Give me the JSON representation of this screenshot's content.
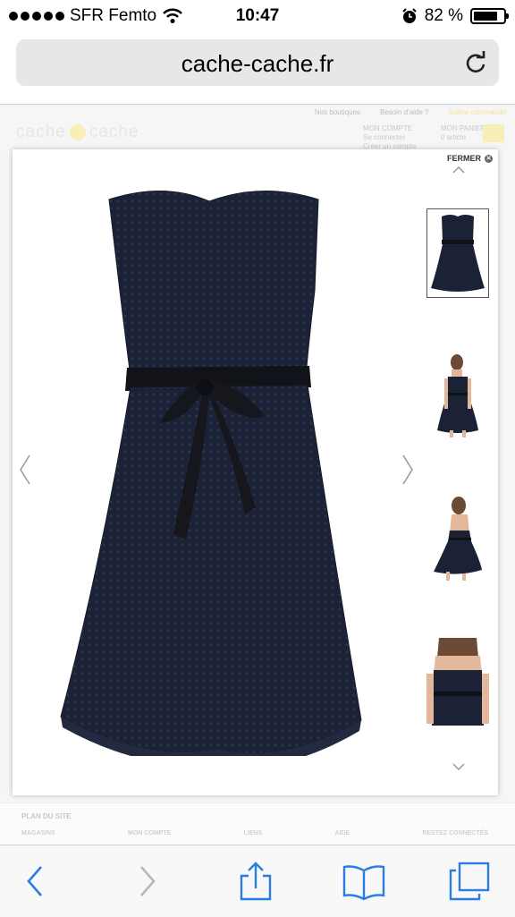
{
  "status_bar": {
    "carrier": "SFR Femto",
    "time": "10:47",
    "battery_percent": "82 %",
    "battery_level": 0.82,
    "icons": [
      "signal-dots-icon",
      "wifi-icon",
      "alarm-icon",
      "battery-icon"
    ]
  },
  "browser": {
    "url": "cache-cache.fr",
    "reload_icon": "reload-icon"
  },
  "site": {
    "top_links": [
      "Nos boutiques",
      "Besoin d'aide ?",
      "Suivre commande"
    ],
    "logo_text_left": "cache",
    "logo_text_right": "cache",
    "account_title": "MON COMPTE",
    "account_sub1": "Se connecter",
    "account_sub2": "Créer un compte",
    "basket_title": "MON PANIER",
    "basket_count": "0 article",
    "footer_title": "PLAN DU SITE",
    "footer_cols": [
      "MAGASINS",
      "MON COMPTE",
      "LIENS",
      "AIDE",
      "RESTEZ CONNECTÉS"
    ]
  },
  "modal": {
    "close_label": "FERMER",
    "prev_icon": "chevron-left-icon",
    "next_icon": "chevron-right-icon",
    "thumb_up_icon": "chevron-up-icon",
    "thumb_down_icon": "chevron-down-icon",
    "thumbnails": [
      "dress-front",
      "model-front",
      "model-back",
      "model-closeup"
    ],
    "selected_thumbnail": 0
  },
  "toolbar": {
    "icons": [
      "back-icon",
      "forward-icon",
      "share-icon",
      "bookmarks-icon",
      "tabs-icon"
    ]
  },
  "colors": {
    "dress": "#1c2236",
    "accent_yellow": "#f7eeb8",
    "ios_blue": "#2a7de1"
  }
}
